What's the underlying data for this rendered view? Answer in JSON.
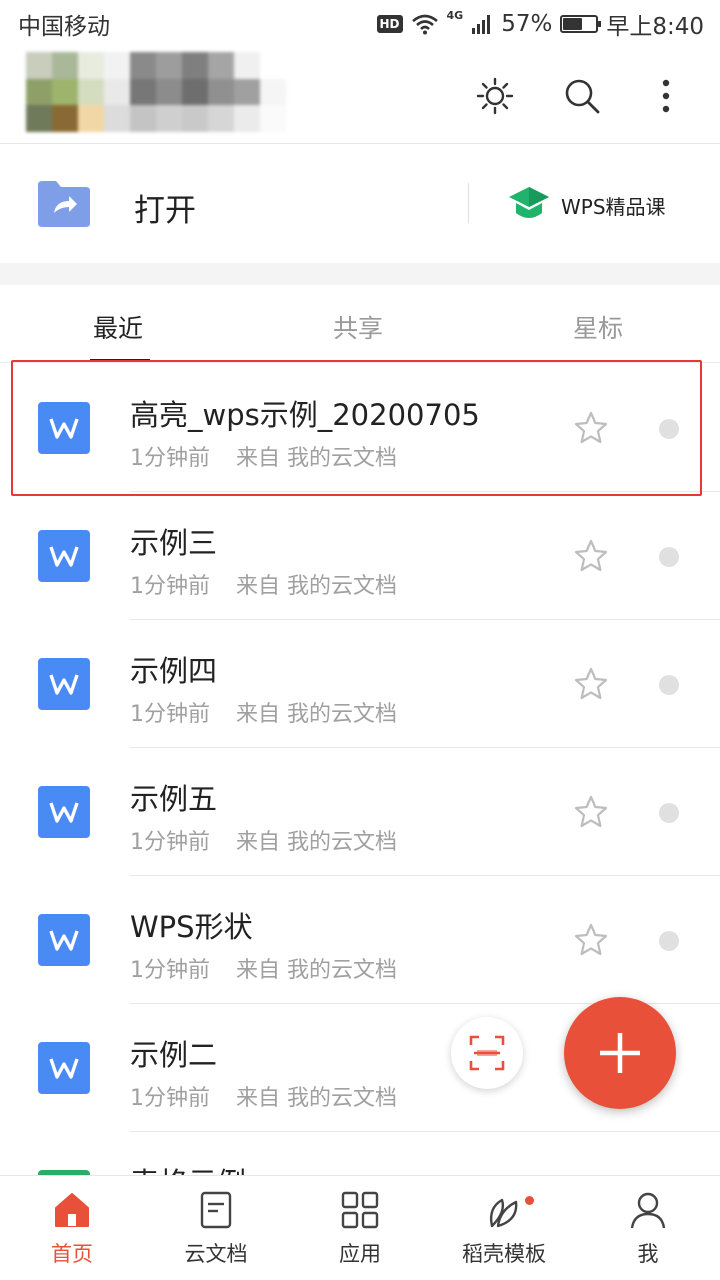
{
  "status_bar": {
    "carrier": "中国移动",
    "hd": "HD",
    "network": "4G",
    "battery": "57%",
    "battery_level": 0.57,
    "time": "早上8:40"
  },
  "header": {
    "icons": [
      "brightness-icon",
      "search-icon",
      "more-vertical-icon"
    ]
  },
  "quick_actions": {
    "open_label": "打开",
    "course_label": "WPS精品课"
  },
  "tabs": [
    {
      "label": "最近",
      "active": true
    },
    {
      "label": "共享",
      "active": false
    },
    {
      "label": "星标",
      "active": false
    }
  ],
  "files": [
    {
      "name": "高亮_wps示例_20200705",
      "time": "1分钟前",
      "source": "来自 我的云文档",
      "type": "writer",
      "highlighted": true
    },
    {
      "name": "示例三",
      "time": "1分钟前",
      "source": "来自 我的云文档",
      "type": "writer"
    },
    {
      "name": "示例四",
      "time": "1分钟前",
      "source": "来自 我的云文档",
      "type": "writer"
    },
    {
      "name": "示例五",
      "time": "1分钟前",
      "source": "来自 我的云文档",
      "type": "writer"
    },
    {
      "name": "WPS形状",
      "time": "1分钟前",
      "source": "来自 我的云文档",
      "type": "writer"
    },
    {
      "name": "示例二",
      "time": "1分钟前",
      "source": "来自 我的云文档",
      "type": "writer"
    },
    {
      "name": "表格示例",
      "time": "",
      "source": "",
      "type": "sheet"
    }
  ],
  "colors": {
    "accent": "#e8503a",
    "writer_blue": "#4a8af4",
    "highlight_red": "#e53935",
    "course_green": "#1fb36b"
  },
  "bottom_nav": [
    {
      "label": "首页",
      "icon": "home-icon",
      "active": true
    },
    {
      "label": "云文档",
      "icon": "cloud-doc-icon",
      "active": false
    },
    {
      "label": "应用",
      "icon": "apps-grid-icon",
      "active": false
    },
    {
      "label": "稻壳模板",
      "icon": "template-leaf-icon",
      "active": false
    },
    {
      "label": "我",
      "icon": "profile-icon",
      "active": false
    }
  ]
}
